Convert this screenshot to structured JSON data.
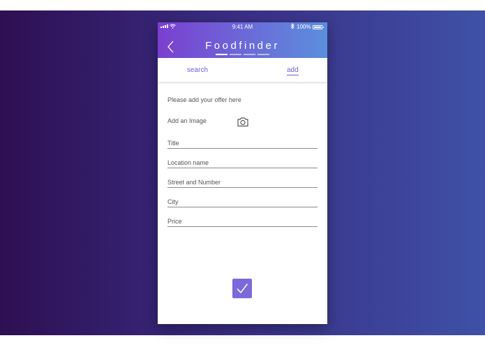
{
  "status_bar": {
    "time": "9:41 AM",
    "battery": "100%"
  },
  "header": {
    "title": "Foodfinder",
    "back_icon": "chevron-left-icon",
    "page_dots": 4,
    "active_dot": 0
  },
  "tabs": [
    {
      "label": "search",
      "active": false
    },
    {
      "label": "add",
      "active": true
    }
  ],
  "form": {
    "intro": "Please add your offer here",
    "image_label": "Add an Image",
    "image_icon": "camera-icon",
    "fields": {
      "title": "Title",
      "location": "Location name",
      "street": "Street and Number",
      "city": "City",
      "price": "Price"
    },
    "confirm_icon": "checkmark-icon"
  },
  "colors": {
    "accent": "#6c5fcf",
    "header_start": "#7b3fd0",
    "header_end": "#5b8fdc",
    "confirm_button": "#7c6ad8"
  }
}
